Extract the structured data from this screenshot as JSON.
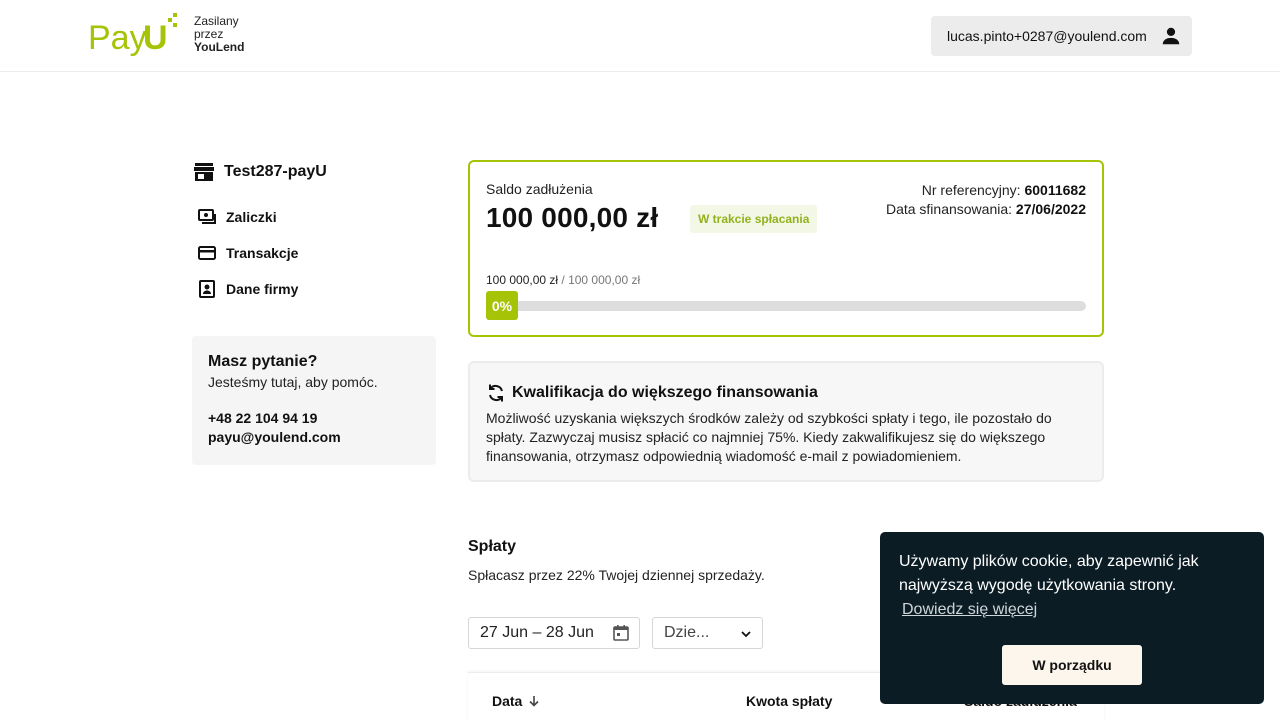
{
  "header": {
    "logo_text": "PayU",
    "powered_line1": "Zasilany",
    "powered_line2": "przez",
    "powered_brand": "YouLend",
    "user_email": "lucas.pinto+0287@youlend.com"
  },
  "sidebar": {
    "merchant_name": "Test287-payU",
    "items": [
      {
        "label": "Zaliczki",
        "icon": "cash-icon"
      },
      {
        "label": "Transakcje",
        "icon": "credit-card-icon"
      },
      {
        "label": "Dane firmy",
        "icon": "contact-card-icon"
      }
    ],
    "help": {
      "title": "Masz pytanie?",
      "subtitle": "Jesteśmy tutaj, aby pomóc.",
      "phone": "+48 22 104 94 19",
      "email": "payu@youlend.com"
    }
  },
  "balance": {
    "label": "Saldo zadłużenia",
    "amount": "100 000,00 zł",
    "status_badge": "W trakcie spłacania",
    "ref_label": "Nr referencyjny:",
    "ref_value": "60011682",
    "funded_label": "Data sfinansowania:",
    "funded_value": "27/06/2022",
    "progress_current": "100 000,00 zł",
    "progress_total": "100 000,00 zł",
    "progress_separator": " / ",
    "progress_percent_label": "0%",
    "progress_fraction": 0.0,
    "accent_color": "#a6c307"
  },
  "qualification": {
    "title": "Kwalifikacja do większego finansowania",
    "body": "Możliwość uzyskania większych środków zależy od szybkości spłaty i tego, ile pozostało do spłaty. Zazwyczaj musisz spłacić co najmniej 75%. Kiedy zakwalifikujesz się do większego finansowania, otrzymasz odpowiednią wiadomość e-mail z powiadomieniem."
  },
  "repayments": {
    "title": "Spłaty",
    "subtitle": "Spłacasz przez 22% Twojej dziennej sprzedaży.",
    "date_range": "27 Jun – 28 Jun",
    "period_select": "Dzie...",
    "columns": [
      "Data",
      "Kwota spłaty",
      "Saldo zadłużenia"
    ]
  },
  "cookie": {
    "text": "Używamy plików cookie, aby zapewnić jak najwyższą wygodę użytkowania strony.",
    "link": "Dowiedz się więcej",
    "button": "W porządku",
    "bg_color": "#0b1c24"
  }
}
